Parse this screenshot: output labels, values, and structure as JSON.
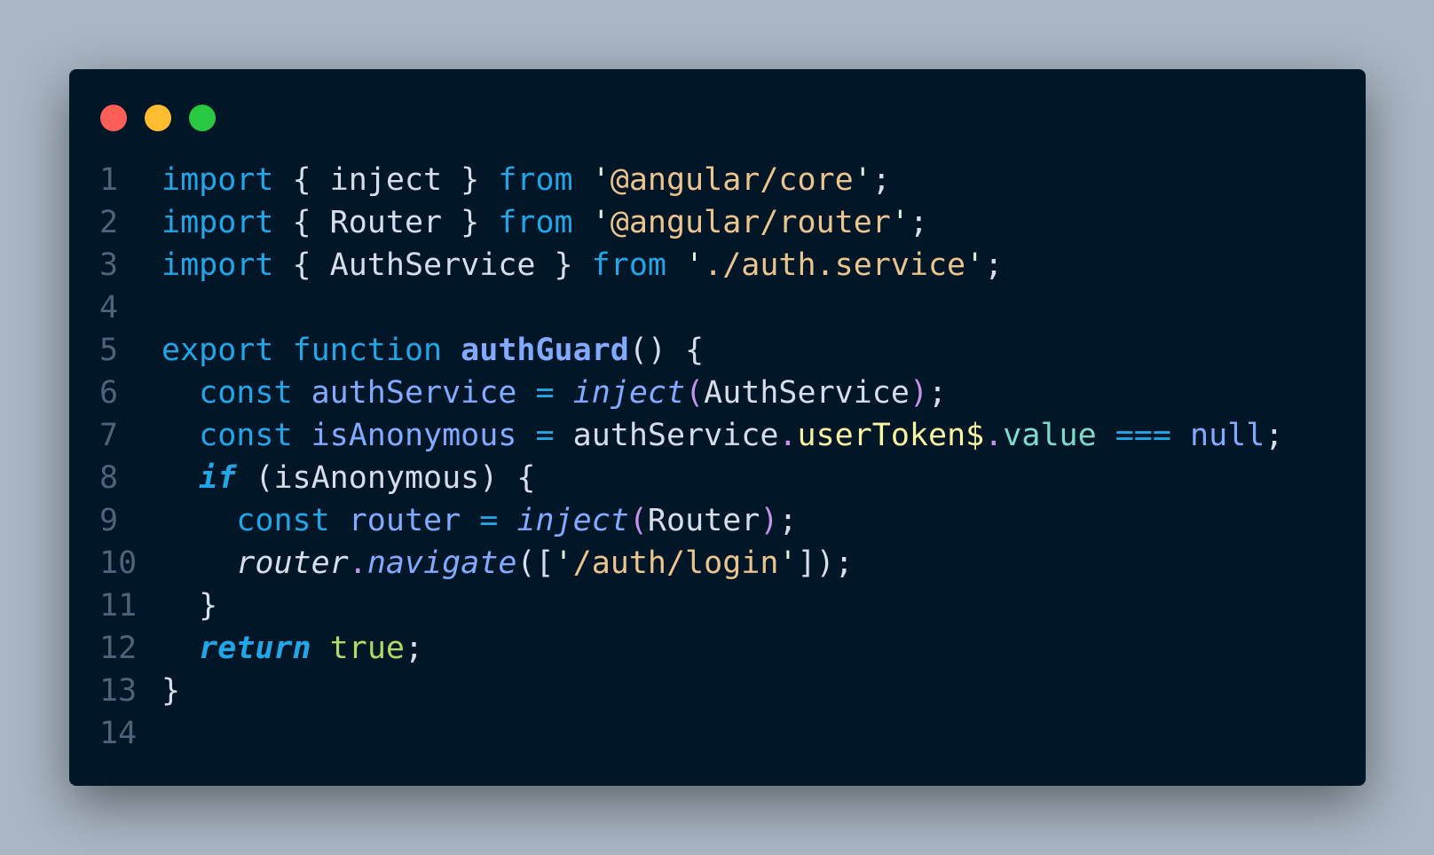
{
  "colors": {
    "background": "#a9b6c3",
    "editor": "#011627",
    "close": "#ff5f57",
    "minimize": "#febc2e",
    "maximize": "#28c840",
    "line_number": "#4b6479"
  },
  "window": {
    "controls": [
      {
        "name": "close",
        "color": "#ff5f57"
      },
      {
        "name": "minimize",
        "color": "#febc2e"
      },
      {
        "name": "maximize",
        "color": "#28c840"
      }
    ]
  },
  "code": {
    "lines": [
      {
        "number": "1",
        "tokens": [
          {
            "text": "import",
            "color": "#21a6e7"
          },
          {
            "text": " { inject } ",
            "color": "#d6deeb"
          },
          {
            "text": "from",
            "color": "#21a6e7"
          },
          {
            "text": " ",
            "color": "#d6deeb"
          },
          {
            "text": "'",
            "color": "#d9f5dd"
          },
          {
            "text": "@angular/core",
            "color": "#ecc48d"
          },
          {
            "text": "'",
            "color": "#d9f5dd"
          },
          {
            "text": ";",
            "color": "#d6deeb"
          }
        ]
      },
      {
        "number": "2",
        "tokens": [
          {
            "text": "import",
            "color": "#21a6e7"
          },
          {
            "text": " { Router } ",
            "color": "#d6deeb"
          },
          {
            "text": "from",
            "color": "#21a6e7"
          },
          {
            "text": " ",
            "color": "#d6deeb"
          },
          {
            "text": "'",
            "color": "#d9f5dd"
          },
          {
            "text": "@angular/router",
            "color": "#ecc48d"
          },
          {
            "text": "'",
            "color": "#d9f5dd"
          },
          {
            "text": ";",
            "color": "#d6deeb"
          }
        ]
      },
      {
        "number": "3",
        "tokens": [
          {
            "text": "import",
            "color": "#21a6e7"
          },
          {
            "text": " { AuthService } ",
            "color": "#d6deeb"
          },
          {
            "text": "from",
            "color": "#21a6e7"
          },
          {
            "text": " ",
            "color": "#d6deeb"
          },
          {
            "text": "'",
            "color": "#d9f5dd"
          },
          {
            "text": "./auth.service",
            "color": "#ecc48d"
          },
          {
            "text": "'",
            "color": "#d9f5dd"
          },
          {
            "text": ";",
            "color": "#d6deeb"
          }
        ]
      },
      {
        "number": "4",
        "tokens": []
      },
      {
        "number": "5",
        "tokens": [
          {
            "text": "export",
            "color": "#21a6e7"
          },
          {
            "text": " ",
            "color": "#d6deeb"
          },
          {
            "text": "function",
            "color": "#21a6e7"
          },
          {
            "text": " ",
            "color": "#d6deeb"
          },
          {
            "text": "authGuard",
            "color": "#82aaff",
            "bold": true
          },
          {
            "text": "() {",
            "color": "#d6deeb"
          }
        ]
      },
      {
        "number": "6",
        "tokens": [
          {
            "text": "  ",
            "color": "#d6deeb"
          },
          {
            "text": "const",
            "color": "#21a6e7"
          },
          {
            "text": " ",
            "color": "#d6deeb"
          },
          {
            "text": "authService",
            "color": "#82aaff"
          },
          {
            "text": " ",
            "color": "#d6deeb"
          },
          {
            "text": "=",
            "color": "#21a6e7"
          },
          {
            "text": " ",
            "color": "#d6deeb"
          },
          {
            "text": "inject",
            "color": "#82aaff",
            "italic": true
          },
          {
            "text": "(",
            "color": "#c792ea"
          },
          {
            "text": "AuthService",
            "color": "#d6deeb"
          },
          {
            "text": ")",
            "color": "#c792ea"
          },
          {
            "text": ";",
            "color": "#d6deeb"
          }
        ]
      },
      {
        "number": "7",
        "tokens": [
          {
            "text": "  ",
            "color": "#d6deeb"
          },
          {
            "text": "const",
            "color": "#21a6e7"
          },
          {
            "text": " ",
            "color": "#d6deeb"
          },
          {
            "text": "isAnonymous",
            "color": "#82aaff"
          },
          {
            "text": " ",
            "color": "#d6deeb"
          },
          {
            "text": "=",
            "color": "#21a6e7"
          },
          {
            "text": " authService",
            "color": "#d6deeb"
          },
          {
            "text": ".",
            "color": "#c792ea"
          },
          {
            "text": "userToken$",
            "color": "#faf39f"
          },
          {
            "text": ".",
            "color": "#c792ea"
          },
          {
            "text": "value",
            "color": "#7fdbca"
          },
          {
            "text": " ",
            "color": "#d6deeb"
          },
          {
            "text": "===",
            "color": "#21a6e7"
          },
          {
            "text": " ",
            "color": "#d6deeb"
          },
          {
            "text": "null",
            "color": "#82aaff"
          },
          {
            "text": ";",
            "color": "#d6deeb"
          }
        ]
      },
      {
        "number": "8",
        "tokens": [
          {
            "text": "  ",
            "color": "#d6deeb"
          },
          {
            "text": "if",
            "color": "#21a6e7",
            "italic": true,
            "bold": true
          },
          {
            "text": " (isAnonymous) {",
            "color": "#d6deeb"
          }
        ]
      },
      {
        "number": "9",
        "tokens": [
          {
            "text": "    ",
            "color": "#d6deeb"
          },
          {
            "text": "const",
            "color": "#21a6e7"
          },
          {
            "text": " ",
            "color": "#d6deeb"
          },
          {
            "text": "router",
            "color": "#82aaff"
          },
          {
            "text": " ",
            "color": "#d6deeb"
          },
          {
            "text": "=",
            "color": "#21a6e7"
          },
          {
            "text": " ",
            "color": "#d6deeb"
          },
          {
            "text": "inject",
            "color": "#82aaff",
            "italic": true
          },
          {
            "text": "(",
            "color": "#c792ea"
          },
          {
            "text": "Router",
            "color": "#d6deeb"
          },
          {
            "text": ")",
            "color": "#c792ea"
          },
          {
            "text": ";",
            "color": "#d6deeb"
          }
        ]
      },
      {
        "number": "10",
        "tokens": [
          {
            "text": "    ",
            "color": "#d6deeb"
          },
          {
            "text": "router",
            "color": "#d6deeb",
            "italic": true
          },
          {
            "text": ".",
            "color": "#c792ea"
          },
          {
            "text": "navigate",
            "color": "#82aaff",
            "italic": true
          },
          {
            "text": "([",
            "color": "#d6deeb"
          },
          {
            "text": "'",
            "color": "#d9f5dd"
          },
          {
            "text": "/auth/login",
            "color": "#ecc48d"
          },
          {
            "text": "'",
            "color": "#d9f5dd"
          },
          {
            "text": "]);",
            "color": "#d6deeb"
          }
        ]
      },
      {
        "number": "11",
        "tokens": [
          {
            "text": "  }",
            "color": "#d6deeb"
          }
        ]
      },
      {
        "number": "12",
        "tokens": [
          {
            "text": "  ",
            "color": "#d6deeb"
          },
          {
            "text": "return",
            "color": "#21a6e7",
            "italic": true,
            "bold": true
          },
          {
            "text": " ",
            "color": "#d6deeb"
          },
          {
            "text": "true",
            "color": "#addb67"
          },
          {
            "text": ";",
            "color": "#d6deeb"
          }
        ]
      },
      {
        "number": "13",
        "tokens": [
          {
            "text": "}",
            "color": "#d6deeb"
          }
        ]
      },
      {
        "number": "14",
        "tokens": []
      }
    ]
  }
}
